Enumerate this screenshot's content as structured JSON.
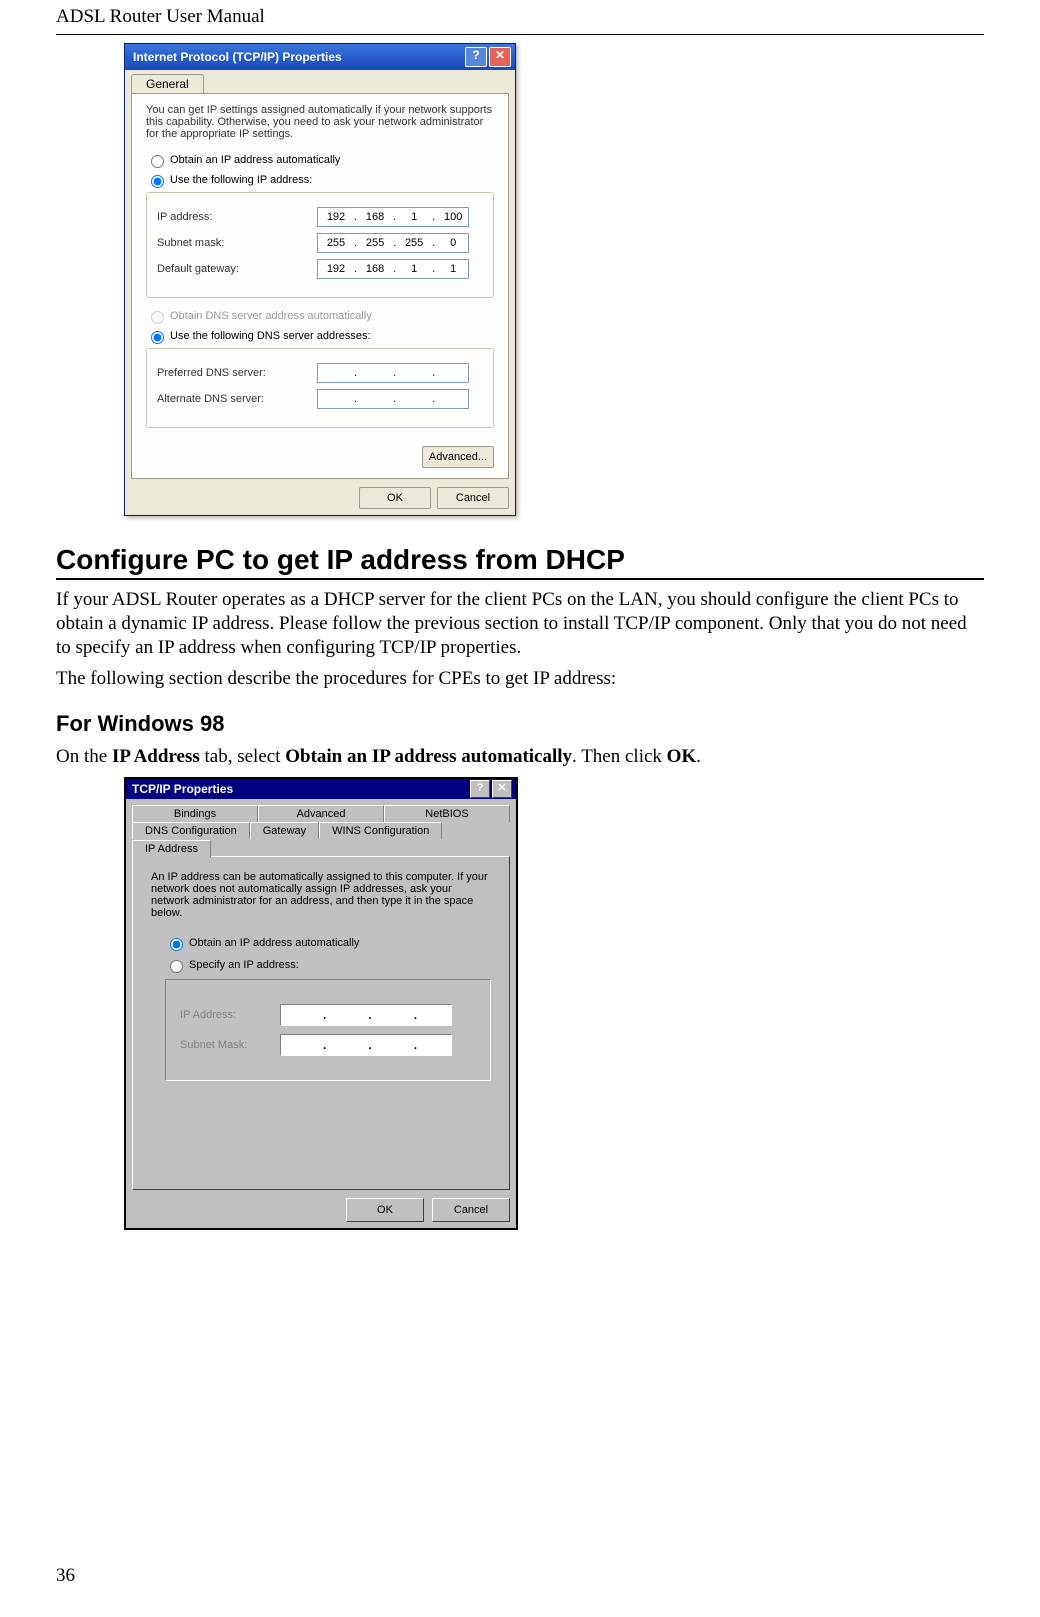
{
  "doc": {
    "running_header": "ADSL Router User Manual",
    "page_number": "36"
  },
  "section": {
    "heading": "Configure PC to get IP address from DHCP",
    "para1": "If your ADSL Router operates as a DHCP server for the client PCs on the LAN, you should configure the client PCs to obtain a dynamic IP address. Please follow the previous section to install TCP/IP component. Only that you do not need to specify an IP address when configuring TCP/IP properties.",
    "para2": "The following section describe the procedures for CPEs to get IP address:"
  },
  "sub": {
    "heading": "For Windows 98",
    "intro_prefix": "On the ",
    "intro_bold1": "IP Address",
    "intro_mid": " tab, select ",
    "intro_bold2": "Obtain an IP address automatically",
    "intro_mid2": ". Then click ",
    "intro_bold3": "OK",
    "intro_suffix": "."
  },
  "xp": {
    "title": "Internet Protocol (TCP/IP) Properties",
    "help_glyph": "?",
    "close_glyph": "✕",
    "tab": "General",
    "desc": "You can get IP settings assigned automatically if your network supports this capability. Otherwise, you need to ask your network administrator for the appropriate IP settings.",
    "radio_auto_ip": "Obtain an IP address automatically",
    "radio_use_ip": "Use the following IP address:",
    "lbl_ip": "IP address:",
    "lbl_mask": "Subnet mask:",
    "lbl_gw": "Default gateway:",
    "ip": [
      "192",
      "168",
      "1",
      "100"
    ],
    "mask": [
      "255",
      "255",
      "255",
      "0"
    ],
    "gw": [
      "192",
      "168",
      "1",
      "1"
    ],
    "radio_auto_dns": "Obtain DNS server address automatically",
    "radio_use_dns": "Use the following DNS server addresses:",
    "lbl_pref_dns": "Preferred DNS server:",
    "lbl_alt_dns": "Alternate DNS server:",
    "btn_adv": "Advanced...",
    "btn_ok": "OK",
    "btn_cancel": "Cancel"
  },
  "w98": {
    "title": "TCP/IP Properties",
    "help_glyph": "?",
    "close_glyph": "✕",
    "tabs_row1": [
      "Bindings",
      "Advanced",
      "NetBIOS"
    ],
    "tabs_row2": [
      "DNS Configuration",
      "Gateway",
      "WINS Configuration",
      "IP Address"
    ],
    "active_tab": "IP Address",
    "desc": "An IP address can be automatically assigned to this computer. If your network does not automatically assign IP addresses, ask your network administrator for an address, and then type it in the space below.",
    "radio_auto": "Obtain an IP address automatically",
    "radio_specify": "Specify an IP address:",
    "lbl_ip": "IP Address:",
    "lbl_mask": "Subnet Mask:",
    "btn_ok": "OK",
    "btn_cancel": "Cancel"
  }
}
